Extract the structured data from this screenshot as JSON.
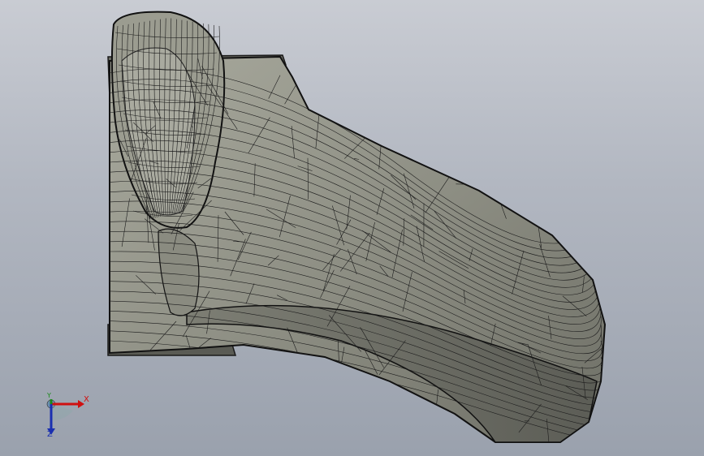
{
  "viewport": {
    "background_top": "#c9ccd3",
    "background_bottom": "#9aa1ad",
    "model_fill": "#8c8d82",
    "model_shade": "#5f605a",
    "wire_color": "#1c1c1c"
  },
  "triad": {
    "x_label": "X",
    "y_label": "Y",
    "z_label": "Z",
    "x_color": "#d01010",
    "y_color": "#1a8a1a",
    "z_color": "#1a2fb0"
  }
}
